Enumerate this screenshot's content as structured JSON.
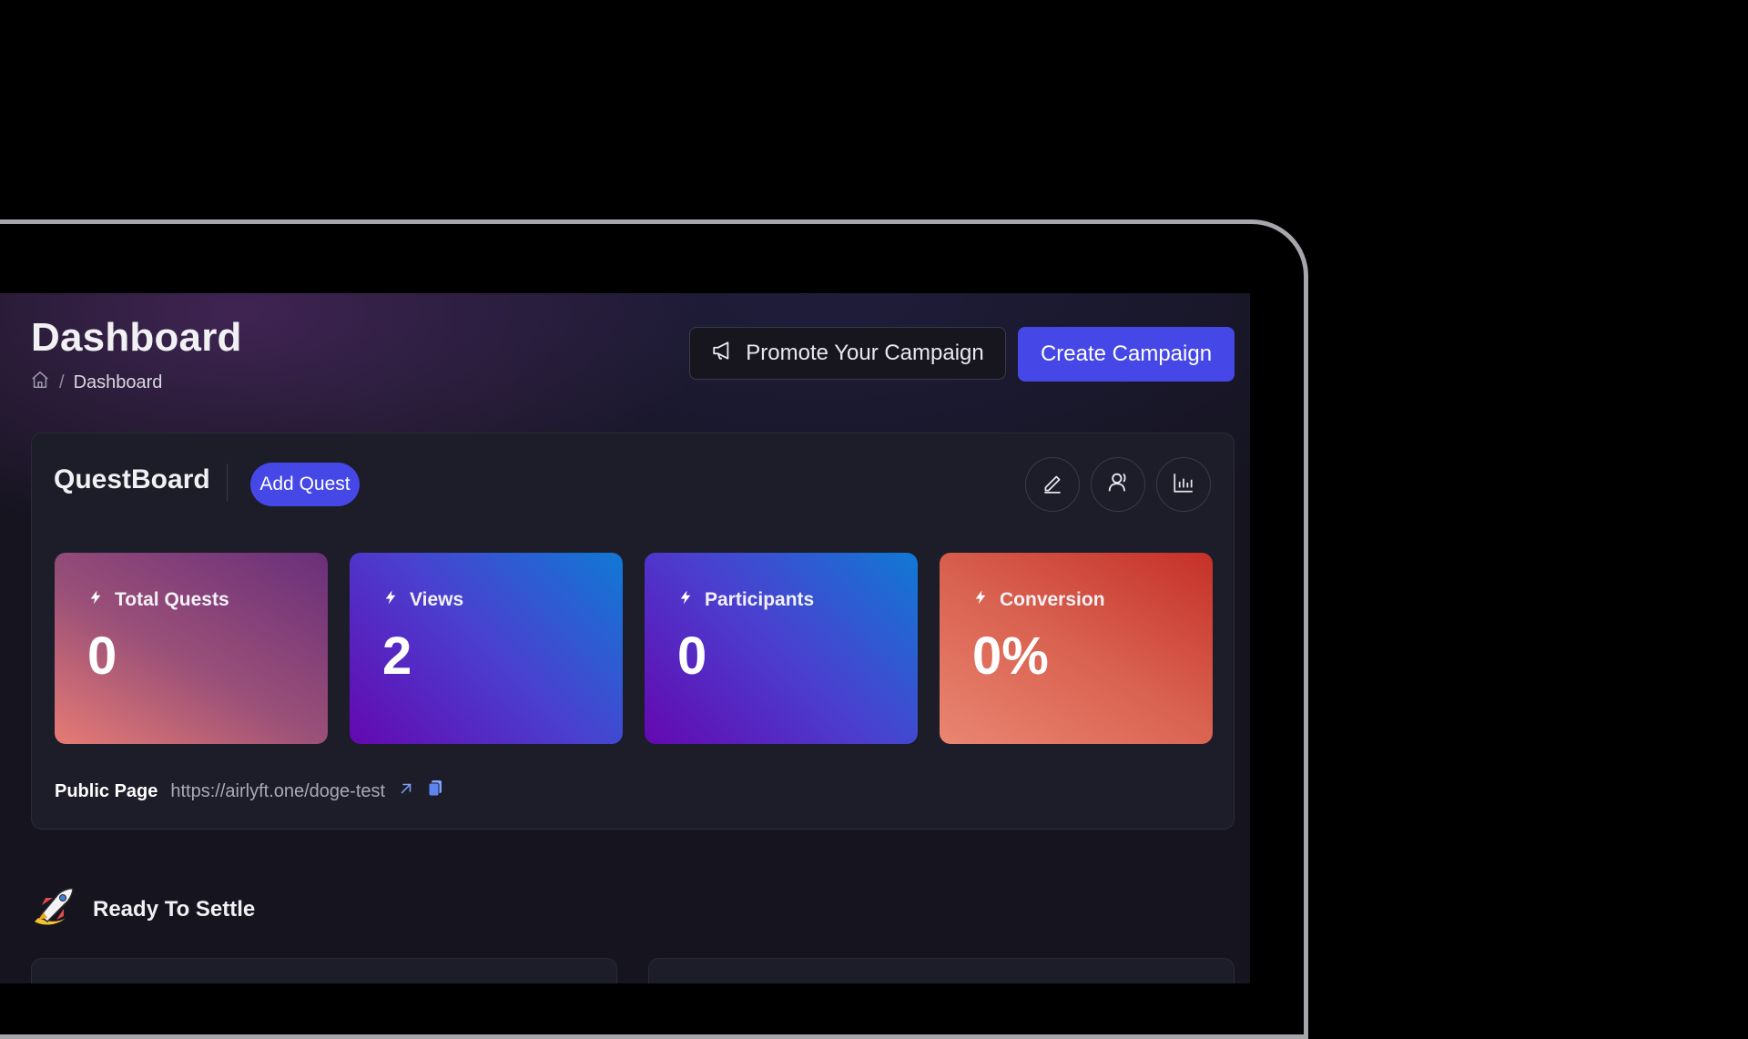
{
  "header": {
    "title": "Dashboard",
    "breadcrumb": {
      "separator": "/",
      "current": "Dashboard",
      "home_icon": "home-icon"
    },
    "promote_label": "Promote Your Campaign",
    "promote_icon": "megaphone-icon",
    "create_label": "Create Campaign"
  },
  "questboard": {
    "title": "QuestBoard",
    "add_label": "Add Quest",
    "actions": [
      "edit-icon",
      "users-icon",
      "bar-chart-icon"
    ],
    "stats": [
      {
        "label": "Total Quests",
        "value": "0",
        "icon": "lightning-icon"
      },
      {
        "label": "Views",
        "value": "2",
        "icon": "lightning-icon"
      },
      {
        "label": "Participants",
        "value": "0",
        "icon": "lightning-icon"
      },
      {
        "label": "Conversion",
        "value": "0%",
        "icon": "lightning-icon"
      }
    ],
    "public_page": {
      "label": "Public Page",
      "url": "https://airlyft.one/doge-test",
      "icons": [
        "external-link-icon",
        "copy-icon"
      ]
    }
  },
  "settle": {
    "title": "Ready To Settle",
    "icon": "rocket-icon"
  },
  "colors": {
    "accent": "#4548e6",
    "background": "#15141f",
    "panel": "#1d1c29"
  }
}
